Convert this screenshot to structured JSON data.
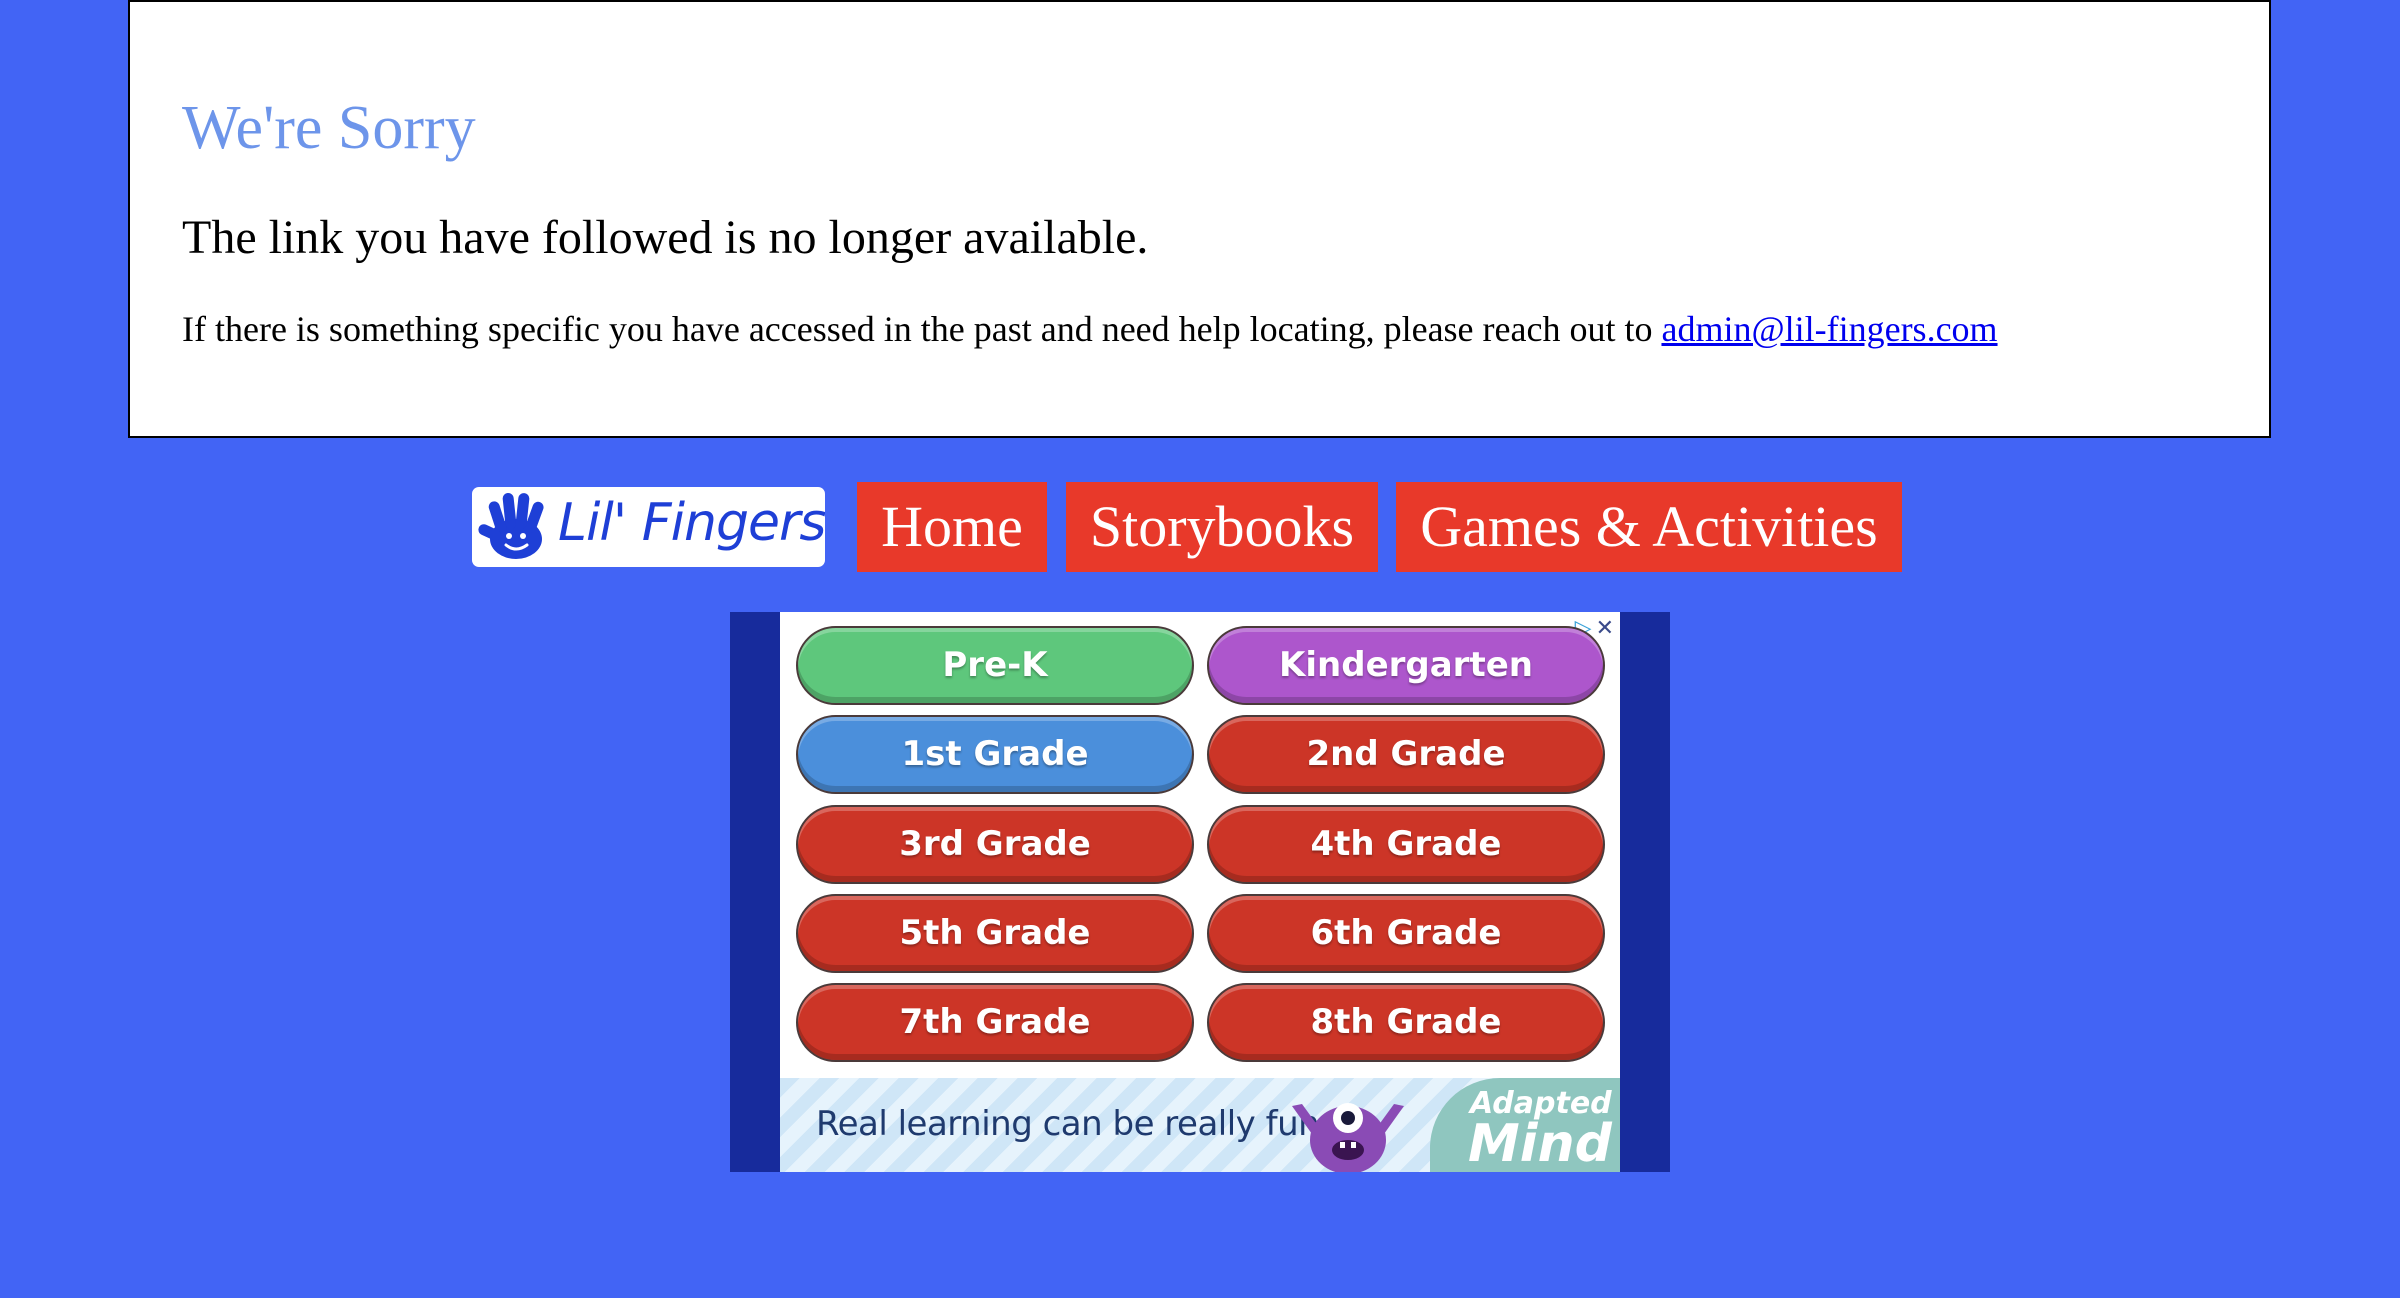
{
  "error": {
    "title": "We're Sorry",
    "subtitle": "The link you have followed is no longer available.",
    "help_text": "If there is something specific you have accessed in the past and need help locating, please reach out to ",
    "email": "admin@lil-fingers.com"
  },
  "nav": {
    "logo_text": "Lil' Fingers",
    "items": [
      {
        "label": "Home"
      },
      {
        "label": "Storybooks"
      },
      {
        "label": "Games & Activities"
      }
    ]
  },
  "ad": {
    "choices_icon": "ad-choices-icon",
    "close_symbol": "✕",
    "grades": [
      {
        "label": "Pre-K",
        "color": "#5ec77c"
      },
      {
        "label": "Kindergarten",
        "color": "#ad56cc"
      },
      {
        "label": "1st Grade",
        "color": "#4b8fdb"
      },
      {
        "label": "2nd Grade",
        "color": "#cc3527"
      },
      {
        "label": "3rd Grade",
        "color": "#cc3527"
      },
      {
        "label": "4th Grade",
        "color": "#cc3527"
      },
      {
        "label": "5th Grade",
        "color": "#cc3527"
      },
      {
        "label": "6th Grade",
        "color": "#cc3527"
      },
      {
        "label": "7th Grade",
        "color": "#cc3527"
      },
      {
        "label": "8th Grade",
        "color": "#cc3527"
      }
    ],
    "tagline": "Real learning can be really fun",
    "brand_line1": "Adapted",
    "brand_line2": "Mind"
  },
  "colors": {
    "page_background": "#4264f5",
    "title": "#6d95ea",
    "nav_button": "#e8392a",
    "link": "#0000ee"
  }
}
